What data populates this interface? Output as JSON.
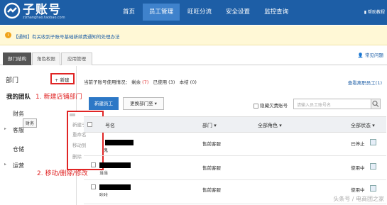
{
  "header": {
    "logo_title": "子账号",
    "logo_sub": "zizhanghao.taobao.com",
    "nav": [
      "首页",
      "员工管理",
      "旺旺分流",
      "安全设置",
      "监控查询"
    ],
    "help": "帮助教程"
  },
  "notice": {
    "text": "【通知】有关收到子账号基础新续费通知的处理办法"
  },
  "tabs": {
    "items": [
      "部门结构",
      "角色权限",
      "应用管理"
    ],
    "user_link": "常见问题"
  },
  "sidebar": {
    "title": "部门",
    "new_button": "+ 新建",
    "team": "我的团队",
    "items": [
      "财务",
      "客服",
      "仓储",
      "运营"
    ],
    "tooltip": "财务"
  },
  "context_menu": {
    "items": [
      "新建子部门",
      "重命名",
      "移动到",
      "删除"
    ]
  },
  "annotations": {
    "step1": "1. 新建店铺部门",
    "step2": "2. 移动/删除/修改"
  },
  "main": {
    "usage_label": "当前子账号使用情况：",
    "remain_label": "剩余",
    "remain_value": "(7)",
    "used_label": "已使用",
    "used_value": "(3)",
    "bound_label": "本结",
    "bound_value": "(0)",
    "see_link": "查看离职员工(1)",
    "new_employee_btn": "新建员工",
    "move_btn": "更换部门至",
    "hide_label": "隐藏欠费账号",
    "search_placeholder": "请输入员工账号名"
  },
  "table": {
    "headers": [
      "号名",
      "部门",
      "全部角色",
      "全部状态"
    ],
    "rows": [
      {
        "sub": "鬼",
        "dept": "售前客服",
        "status": "已停止"
      },
      {
        "sub": "当当",
        "dept": "售前客服",
        "status": "使用中"
      },
      {
        "sub": "咔咔",
        "dept": "售前客服",
        "status": "使用中"
      }
    ]
  },
  "watermark": "头条号 / 电商团之家"
}
